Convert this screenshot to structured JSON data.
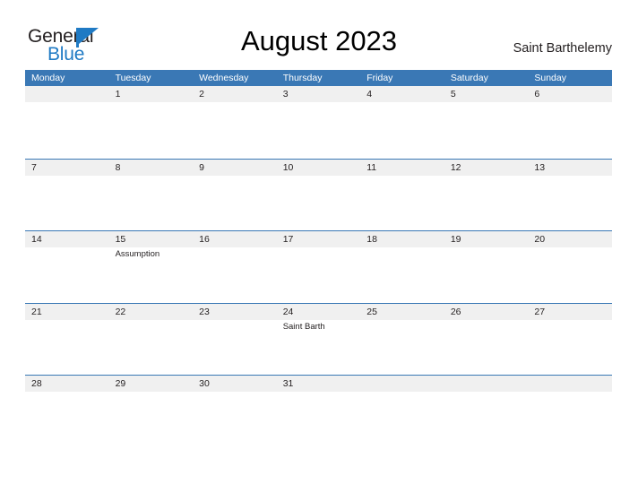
{
  "brand": {
    "name_part1": "General",
    "name_part2": "Blue",
    "logo_icon": "blue-triangle-flag-icon",
    "accent_color": "#1f7ac4"
  },
  "header": {
    "month_title": "August 2023",
    "region": "Saint Barthelemy"
  },
  "calendar": {
    "header_bg": "#3a78b5",
    "band_bg": "#f0f0f0",
    "weekday_headers": [
      "Monday",
      "Tuesday",
      "Wednesday",
      "Thursday",
      "Friday",
      "Saturday",
      "Sunday"
    ],
    "weeks": [
      {
        "days": [
          {
            "num": "",
            "events": []
          },
          {
            "num": "1",
            "events": []
          },
          {
            "num": "2",
            "events": []
          },
          {
            "num": "3",
            "events": []
          },
          {
            "num": "4",
            "events": []
          },
          {
            "num": "5",
            "events": []
          },
          {
            "num": "6",
            "events": []
          }
        ]
      },
      {
        "days": [
          {
            "num": "7",
            "events": []
          },
          {
            "num": "8",
            "events": []
          },
          {
            "num": "9",
            "events": []
          },
          {
            "num": "10",
            "events": []
          },
          {
            "num": "11",
            "events": []
          },
          {
            "num": "12",
            "events": []
          },
          {
            "num": "13",
            "events": []
          }
        ]
      },
      {
        "days": [
          {
            "num": "14",
            "events": []
          },
          {
            "num": "15",
            "events": [
              "Assumption"
            ]
          },
          {
            "num": "16",
            "events": []
          },
          {
            "num": "17",
            "events": []
          },
          {
            "num": "18",
            "events": []
          },
          {
            "num": "19",
            "events": []
          },
          {
            "num": "20",
            "events": []
          }
        ]
      },
      {
        "days": [
          {
            "num": "21",
            "events": []
          },
          {
            "num": "22",
            "events": []
          },
          {
            "num": "23",
            "events": []
          },
          {
            "num": "24",
            "events": [
              "Saint Barth"
            ]
          },
          {
            "num": "25",
            "events": []
          },
          {
            "num": "26",
            "events": []
          },
          {
            "num": "27",
            "events": []
          }
        ]
      },
      {
        "days": [
          {
            "num": "28",
            "events": []
          },
          {
            "num": "29",
            "events": []
          },
          {
            "num": "30",
            "events": []
          },
          {
            "num": "31",
            "events": []
          },
          {
            "num": "",
            "events": []
          },
          {
            "num": "",
            "events": []
          },
          {
            "num": "",
            "events": []
          }
        ]
      }
    ]
  }
}
